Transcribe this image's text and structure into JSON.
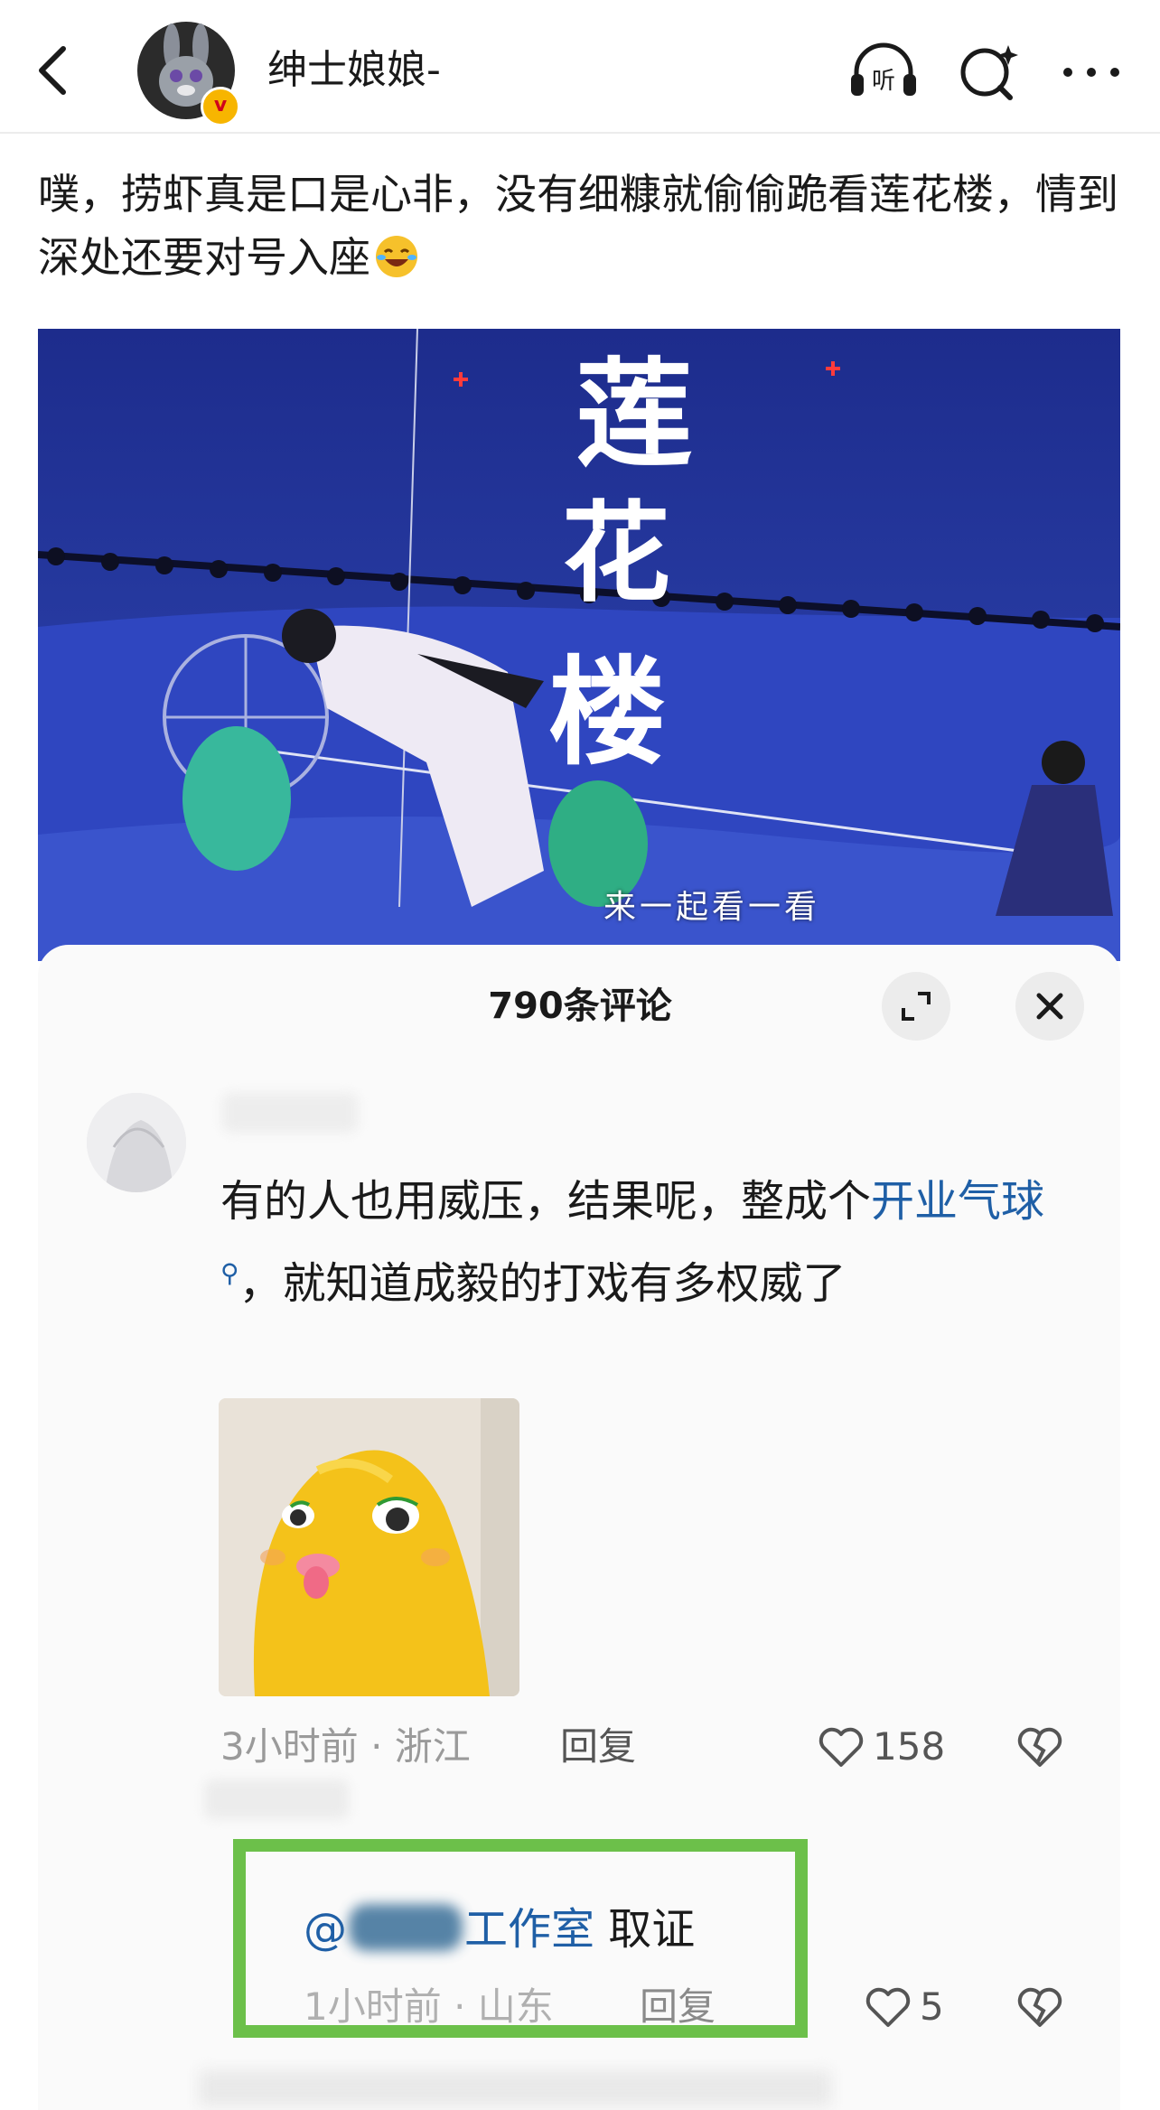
{
  "header": {
    "username": "绅士娘娘-",
    "icons": [
      "back-arrow-icon",
      "headphones-listen-icon",
      "ai-search-icon",
      "more-icon"
    ],
    "listen_label": "听"
  },
  "post": {
    "text": "噗，捞虾真是口是心非，没有细糠就偷偷跪看莲花楼，情到深处还要对号入座",
    "emoji": "rofl-emoji-icon"
  },
  "video": {
    "caption": "来一起看一看",
    "title_art": "莲花楼"
  },
  "comments_sheet": {
    "title": "790条评论"
  },
  "comments": [
    {
      "text_before_link": "有的人也用威压，结果呢，整成个",
      "link": "开业气球",
      "text_after_link": "，就知道成毅的打戏有多权威了",
      "time": "3小时前",
      "location": "浙江",
      "reply": "回复",
      "likes": "158"
    },
    {
      "mention_prefix": "@",
      "mention_suffix": "工作室",
      "text": "取证",
      "time": "1小时前",
      "location": "山东",
      "reply": "回复",
      "likes": "5"
    }
  ],
  "colors": {
    "link": "#1f5fa6",
    "highlight_box": "#6cc04a",
    "meta": "#9a9a9a"
  }
}
